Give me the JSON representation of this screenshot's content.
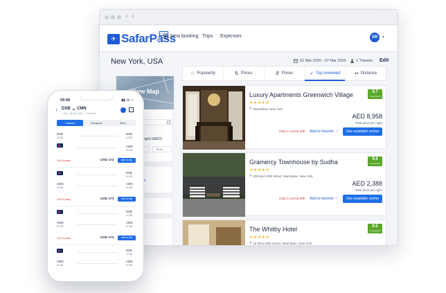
{
  "brand": {
    "name": "SafarPass",
    "tag": "COM",
    "color": "#1e5bd7"
  },
  "nav": [
    {
      "label": "New booking",
      "icon": "plus-box-icon"
    },
    {
      "label": "Trips",
      "icon": ""
    },
    {
      "label": "Expenses",
      "icon": ""
    }
  ],
  "user": {
    "initials": "SR"
  },
  "search": {
    "destination": "New York, USA",
    "dates": "01 Mar 2020 - 07 Mar 2020",
    "travelers": "1 Traveler",
    "edit_label": "Edit"
  },
  "filters": {
    "view_map_label": "View Map",
    "price_label": "r night (AED)",
    "max_placeholder": "imax",
    "link_text": "cy?",
    "policy_label": "olicy"
  },
  "sort_tabs": [
    {
      "label": "Popularity",
      "icon": "star-outline-icon"
    },
    {
      "label": "Prices",
      "icon": "sort-ascending-icon"
    },
    {
      "label": "Prices",
      "icon": "sort-descending-icon"
    },
    {
      "label": "Top reviewed",
      "icon": "check-icon",
      "active": true
    },
    {
      "label": "Distance",
      "icon": "distance-icon"
    }
  ],
  "hotels": [
    {
      "name": "Luxury Apartments Greenwich Village",
      "stars": "★★★★★",
      "address": "Manhattan, New York",
      "score": "9.7",
      "score_word": "Exceptional",
      "price": "AED 8,958",
      "price_note": "Total price per night",
      "availability": "Only 1 rooms left!",
      "favorite_label": "Add to favorite",
      "cta": "See available rooms"
    },
    {
      "name": "Gramercy Townhouse by Sudha",
      "stars": "★★★★★",
      "address": "206 East 20th Street, Manhattan, New York",
      "score": "9.6",
      "score_word": "Exceptional",
      "price": "AED 2,388",
      "price_note": "Total price per night",
      "availability": "Only 1 rooms left!",
      "favorite_label": "Add to favorite",
      "cta": "See available rooms"
    },
    {
      "name": "The Whitby Hotel",
      "stars": "★★★★★",
      "address": "18 West 56th Street, Manhattan, New York",
      "score": "9.5",
      "score_word": "Exceptional"
    }
  ],
  "phone": {
    "time": "09:58",
    "status_icons": "▮▮ ◔ ▭",
    "route_from": "DXB",
    "route_to": "CMN",
    "route_sub": "1 Jan - 28 Jan 2020 · 1 Traveler",
    "tabs": [
      {
        "label": "Fastest",
        "active": true
      },
      {
        "label": "Cheapest"
      },
      {
        "label": "Best"
      }
    ],
    "flights": [
      {
        "from": "DXB",
        "to": "DXB",
        "t1": "17:25",
        "t2": "17:25",
        "from2": "CMN",
        "to2": "CMN",
        "t3": "07:25",
        "t4": "07:25",
        "policy": "Out of policy",
        "price": "USD 173",
        "cta": "Add to trip"
      },
      {
        "from": "DXB",
        "to": "DXB",
        "t1": "17:25",
        "t2": "17:25",
        "from2": "CMN",
        "to2": "CMN",
        "t3": "07:25",
        "t4": "07:25",
        "policy": "Out of policy",
        "price": "USD 173",
        "cta": "Add to trip"
      },
      {
        "from": "DXB",
        "to": "DXB",
        "t1": "17:25",
        "t2": "17:25",
        "from2": "CMN",
        "to2": "CMN",
        "t3": "07:25",
        "t4": "07:25",
        "policy": "Out of policy",
        "price": "USD 173",
        "cta": "Add to trip"
      },
      {
        "from": "DXB",
        "to": "DXB",
        "t1": "17:25",
        "t2": "17:25",
        "from2": "CMN",
        "to2": "CMN",
        "t3": "07:25",
        "t4": "07:25"
      }
    ]
  },
  "colors": {
    "accent": "#1e6ee8",
    "score": "#5aa82a",
    "alert": "#d32f2f",
    "stars": "#f3b51b"
  }
}
